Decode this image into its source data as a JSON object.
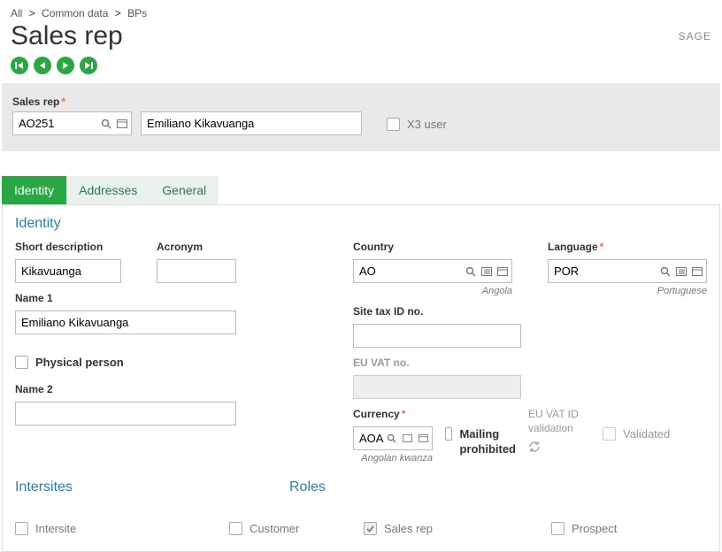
{
  "breadcrumb": {
    "all": "All",
    "mid": "Common data",
    "leaf": "BPs"
  },
  "page_title": "Sales rep",
  "brand": "SAGE",
  "header": {
    "sales_rep_label": "Sales rep",
    "code": "AO251",
    "name": "Emiliano Kikavuanga",
    "x3_user": "X3 user"
  },
  "tabs": {
    "identity": "Identity",
    "addresses": "Addresses",
    "general": "General"
  },
  "identity": {
    "section": "Identity",
    "short_desc_label": "Short description",
    "short_desc": "Kikavuanga",
    "acronym_label": "Acronym",
    "acronym": "",
    "name1_label": "Name 1",
    "name1": "Emiliano Kikavuanga",
    "physical_label": "Physical person",
    "name2_label": "Name 2",
    "name2": "",
    "country_label": "Country",
    "country": "AO",
    "country_name": "Angola",
    "language_label": "Language",
    "language": "POR",
    "language_name": "Portuguese",
    "sitetax_label": "Site tax ID no.",
    "sitetax": "",
    "euvat_label": "EU VAT no.",
    "euvat": "",
    "currency_label": "Currency",
    "currency": "AOA",
    "currency_name": "Angolan kwanza",
    "mailing_label": "Mailing prohibited",
    "euvatid_label": "EU VAT ID validation",
    "validated_label": "Validated"
  },
  "sections": {
    "intersites_title": "Intersites",
    "roles_title": "Roles",
    "intersite": "Intersite",
    "customer": "Customer",
    "sales_rep": "Sales rep",
    "prospect": "Prospect"
  }
}
